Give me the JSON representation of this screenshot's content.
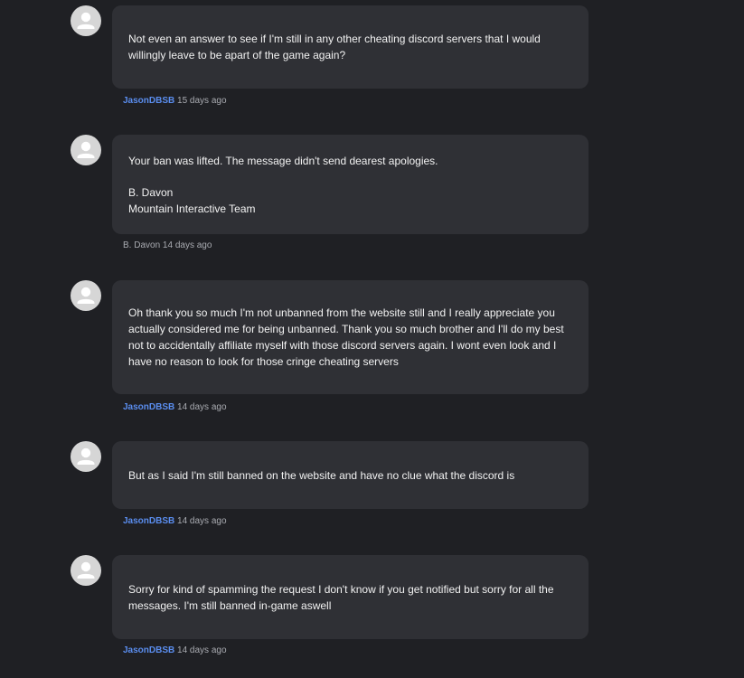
{
  "messages": [
    {
      "author": "JasonDBSB",
      "time": "15 days ago",
      "paragraphs": [
        "Not even an answer to see if I'm still in any other cheating discord servers that I would willingly leave to be apart of the game again?"
      ]
    },
    {
      "author": "B. Davon",
      "time": "14 days ago",
      "paragraphs": [
        "Your ban was lifted. The message didn't send dearest apologies.",
        "B. Davon\nMountain Interactive Team"
      ]
    },
    {
      "author": "JasonDBSB",
      "time": "14 days ago",
      "paragraphs": [
        "Oh thank you so much I'm not unbanned from the website still and I really appreciate you actually considered me for being unbanned. Thank you so much brother and I'll do my best not to accidentally affiliate myself with those discord servers again. I wont even look and I have no reason to look for those cringe cheating servers"
      ]
    },
    {
      "author": "JasonDBSB",
      "time": "14 days ago",
      "paragraphs": [
        "But as I said I'm still banned on the website and have no clue what the discord is"
      ]
    },
    {
      "author": "JasonDBSB",
      "time": "14 days ago",
      "paragraphs": [
        "Sorry for kind of spamming the request I don't know if you get notified but sorry for all the messages. I'm still banned in-game aswell"
      ]
    }
  ],
  "colors": {
    "background": "#1f2024",
    "bubble": "#2f3035",
    "author_link": "#5a8dee",
    "meta_text": "#a9abb1"
  },
  "icons": {
    "avatar": "default-user-icon"
  }
}
